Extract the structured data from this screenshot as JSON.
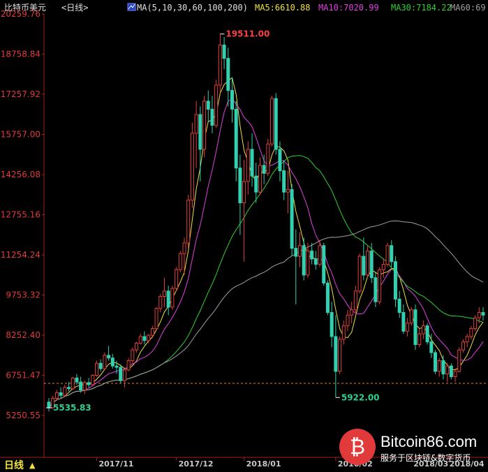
{
  "header": {
    "instrument": "比特币美元",
    "period_label": "<日线>",
    "ma_spec": "MA(5,10,30,60,100,200)",
    "ma_values": [
      {
        "label": "MA5:6610.88",
        "color": "#f0e040"
      },
      {
        "label": "MA10:7020.99",
        "color": "#e040e0"
      },
      {
        "label": "MA30:7184.22",
        "color": "#30d030"
      },
      {
        "label": "MA60:69",
        "color": "#a0a0a0"
      }
    ]
  },
  "footer": {
    "period_button": "日线",
    "period_arrow": "▲"
  },
  "watermark": {
    "brand": "Bitcoin86.com",
    "slogan": "服务于区块链&数字货币",
    "logo_glyph": "₿"
  },
  "colors": {
    "up": "#e0403a",
    "down": "#30d0b0",
    "axis_text": "#e03a3a",
    "ma5": "#f0e040",
    "ma10": "#e040e0",
    "ma30": "#30d030",
    "ma60": "#a0a0a0",
    "ma100": "#d02020",
    "ma200": "#40c0e0",
    "dashed_line": "#e08020"
  },
  "chart_data": {
    "type": "candlestick",
    "title": "比特币美元",
    "y_ticks": [
      "20259.76",
      "18758.84",
      "17257.92",
      "15757.00",
      "14256.08",
      "12755.16",
      "11254.24",
      "9753.32",
      "8252.40",
      "6751.47",
      "5250.55"
    ],
    "x_ticks": [
      "2017/11",
      "2017/12",
      "2018/01",
      "2018/02",
      "2018/03",
      "2018/04"
    ],
    "ylim": [
      4500,
      20259.76
    ],
    "annotations": [
      {
        "label": "19511.00",
        "type": "high"
      },
      {
        "label": "5922.00",
        "type": "low"
      },
      {
        "label": "5535.83",
        "type": "start-low"
      }
    ],
    "reference_line": 6450,
    "candles": [
      [
        5750,
        5900,
        5400,
        5536
      ],
      [
        5540,
        5980,
        5500,
        5890
      ],
      [
        5890,
        6200,
        5800,
        6100
      ],
      [
        6100,
        6300,
        5900,
        6000
      ],
      [
        6000,
        6400,
        5950,
        6300
      ],
      [
        6300,
        6500,
        6150,
        6250
      ],
      [
        6250,
        6700,
        6200,
        6650
      ],
      [
        6650,
        6800,
        6400,
        6500
      ],
      [
        6500,
        6700,
        6100,
        6200
      ],
      [
        6200,
        6550,
        6050,
        6480
      ],
      [
        6480,
        6650,
        6300,
        6400
      ],
      [
        6400,
        6800,
        6350,
        6750
      ],
      [
        6750,
        7300,
        6700,
        7200
      ],
      [
        7200,
        7350,
        6900,
        7000
      ],
      [
        7000,
        7600,
        6950,
        7500
      ],
      [
        7500,
        7850,
        7300,
        7400
      ],
      [
        7400,
        7550,
        7000,
        7100
      ],
      [
        7100,
        7300,
        6800,
        7050
      ],
      [
        7050,
        7150,
        6450,
        6550
      ],
      [
        6550,
        7000,
        6300,
        6950
      ],
      [
        6950,
        7400,
        6900,
        7300
      ],
      [
        7300,
        7800,
        7200,
        7700
      ],
      [
        7700,
        8000,
        7600,
        7950
      ],
      [
        7950,
        8300,
        7900,
        8200
      ],
      [
        8200,
        8400,
        7900,
        8050
      ],
      [
        8050,
        8300,
        7950,
        8250
      ],
      [
        8250,
        8600,
        8150,
        8500
      ],
      [
        8500,
        9300,
        8450,
        9250
      ],
      [
        9250,
        9800,
        9100,
        9700
      ],
      [
        9700,
        10400,
        9300,
        9900
      ],
      [
        9900,
        10100,
        9000,
        9300
      ],
      [
        9300,
        10100,
        9200,
        10000
      ],
      [
        10000,
        10800,
        9900,
        10700
      ],
      [
        10700,
        11400,
        10600,
        11300
      ],
      [
        11300,
        11900,
        10500,
        11700
      ],
      [
        11700,
        13500,
        11500,
        13300
      ],
      [
        13300,
        16200,
        13000,
        15800
      ],
      [
        15800,
        17000,
        14500,
        16500
      ],
      [
        16500,
        16800,
        14000,
        15200
      ],
      [
        15200,
        17200,
        14900,
        17000
      ],
      [
        17000,
        17400,
        16200,
        16700
      ],
      [
        16700,
        17200,
        15800,
        16100
      ],
      [
        16100,
        17800,
        16000,
        17600
      ],
      [
        17600,
        19511,
        17300,
        19100
      ],
      [
        19100,
        19400,
        18200,
        18600
      ],
      [
        18600,
        19000,
        16800,
        17400
      ],
      [
        17400,
        17900,
        16200,
        16700
      ],
      [
        16700,
        17000,
        14000,
        14500
      ],
      [
        14500,
        15000,
        12000,
        13200
      ],
      [
        13200,
        14800,
        11000,
        14000
      ],
      [
        14000,
        15500,
        13500,
        15200
      ],
      [
        15200,
        15800,
        13800,
        14200
      ],
      [
        14200,
        14700,
        13200,
        13600
      ],
      [
        13600,
        14900,
        13500,
        14600
      ],
      [
        14600,
        15000,
        13900,
        14300
      ],
      [
        14300,
        15600,
        14200,
        15400
      ],
      [
        15400,
        17200,
        15300,
        17100
      ],
      [
        17100,
        17300,
        15000,
        15200
      ],
      [
        15200,
        15500,
        14000,
        14400
      ],
      [
        14400,
        14800,
        13300,
        13600
      ],
      [
        13600,
        14400,
        12800,
        13700
      ],
      [
        13700,
        13900,
        11200,
        11500
      ],
      [
        11500,
        12200,
        9400,
        11200
      ],
      [
        11200,
        12100,
        10800,
        11600
      ],
      [
        11600,
        11900,
        10300,
        10500
      ],
      [
        10500,
        11700,
        10400,
        11400
      ],
      [
        11400,
        11700,
        10900,
        11100
      ],
      [
        11100,
        11400,
        10700,
        10900
      ],
      [
        10900,
        11800,
        10800,
        11600
      ],
      [
        11600,
        11700,
        10100,
        10200
      ],
      [
        10200,
        10300,
        9000,
        9100
      ],
      [
        9100,
        9500,
        7800,
        8200
      ],
      [
        8200,
        9000,
        5922,
        6900
      ],
      [
        6900,
        8200,
        6800,
        8100
      ],
      [
        8100,
        8800,
        7900,
        8600
      ],
      [
        8600,
        9200,
        8400,
        9000
      ],
      [
        9000,
        9500,
        8700,
        9200
      ],
      [
        9200,
        10100,
        9100,
        9900
      ],
      [
        9900,
        11300,
        9800,
        11200
      ],
      [
        11200,
        11900,
        10300,
        10500
      ],
      [
        10500,
        11600,
        10400,
        11400
      ],
      [
        11400,
        11700,
        10200,
        10400
      ],
      [
        10400,
        10600,
        9300,
        9500
      ],
      [
        9500,
        10800,
        9400,
        10700
      ],
      [
        10700,
        11100,
        10400,
        10900
      ],
      [
        10900,
        11700,
        10800,
        11600
      ],
      [
        11600,
        11800,
        10800,
        11000
      ],
      [
        11000,
        11200,
        9300,
        9600
      ],
      [
        9600,
        9900,
        8900,
        9100
      ],
      [
        9100,
        9400,
        8300,
        8400
      ],
      [
        8400,
        8900,
        8200,
        8700
      ],
      [
        8700,
        9300,
        8600,
        9200
      ],
      [
        9200,
        9400,
        7700,
        7900
      ],
      [
        7900,
        8500,
        7800,
        8300
      ],
      [
        8300,
        8800,
        8100,
        8600
      ],
      [
        8600,
        8700,
        7900,
        8000
      ],
      [
        8000,
        8300,
        7400,
        7600
      ],
      [
        7600,
        7700,
        6800,
        6900
      ],
      [
        6900,
        7400,
        6700,
        7300
      ],
      [
        7300,
        7500,
        6600,
        6800
      ],
      [
        6800,
        7200,
        6500,
        7100
      ],
      [
        7100,
        7200,
        6600,
        6700
      ],
      [
        6700,
        7000,
        6500,
        6900
      ],
      [
        6900,
        7800,
        6850,
        7700
      ],
      [
        7700,
        8100,
        7600,
        8000
      ],
      [
        8000,
        8300,
        7800,
        8200
      ],
      [
        8200,
        8600,
        8100,
        8500
      ],
      [
        8500,
        9000,
        8400,
        8900
      ],
      [
        8900,
        9300,
        8700,
        9100
      ],
      [
        9100,
        9300,
        8800,
        9000
      ]
    ]
  }
}
